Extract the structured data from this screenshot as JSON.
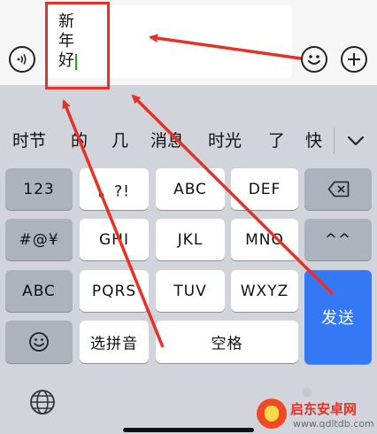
{
  "input": {
    "typed_text": "新年好"
  },
  "candidates": [
    "时节",
    "的",
    "几",
    "消息",
    "时光",
    "了",
    "快"
  ],
  "keyboard": {
    "rows": [
      [
        "123",
        "。?!",
        "ABC",
        "DEF",
        "⌫"
      ],
      [
        "#@¥",
        "GHI",
        "JKL",
        "MNO",
        "^^"
      ],
      [
        "ABC",
        "PQRS",
        "TUV",
        "WXYZ",
        "发送"
      ],
      [
        "☺",
        "选拼音",
        "空格"
      ]
    ],
    "send_label": "发送",
    "space_label": "空格",
    "pinyin_label": "选拼音",
    "num_label": "123",
    "symbol_label": "#@¥",
    "abc_label": "ABC",
    "punct_label": "。?!",
    "abc2_label": "ABC",
    "def_label": "DEF",
    "ghi_label": "GHI",
    "jkl_label": "JKL",
    "mno_label": "MNO",
    "face_label": "^^",
    "pqrs_label": "PQRS",
    "tuv_label": "TUV",
    "wxyz_label": "WXYZ"
  },
  "watermark": {
    "title": "启东安卓网",
    "url": "www.qdltdb.com"
  },
  "colors": {
    "accent": "#3478f6",
    "annotation_red": "#e53127",
    "keyboard_bg": "#d1d4da",
    "function_key": "#adb3bc"
  }
}
